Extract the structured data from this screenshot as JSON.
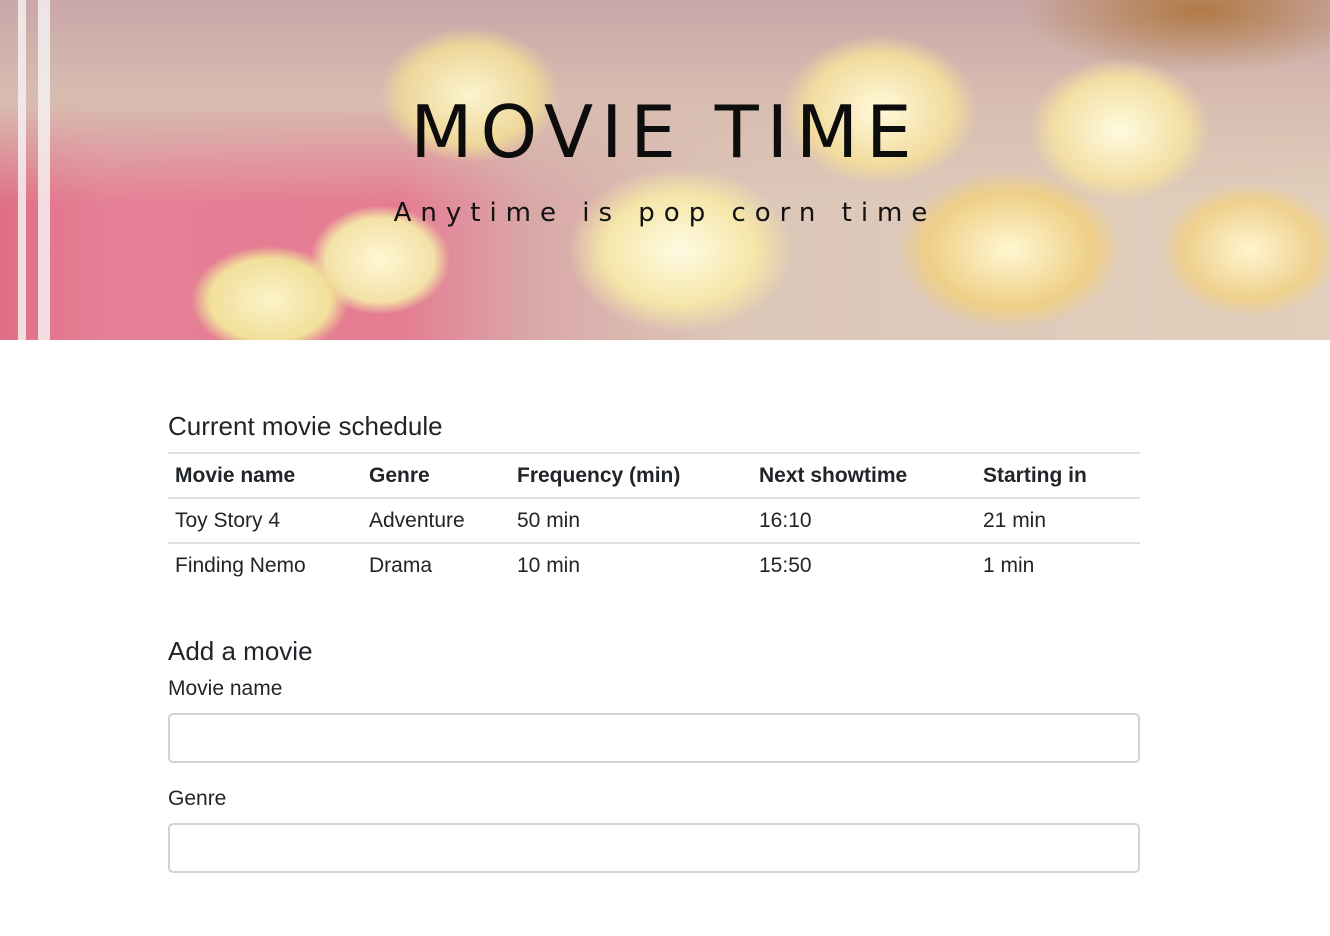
{
  "hero": {
    "title": "MOVIE TIME",
    "subtitle": "Anytime is pop corn time"
  },
  "schedule": {
    "heading": "Current movie schedule",
    "columns": [
      "Movie name",
      "Genre",
      "Frequency (min)",
      "Next showtime",
      "Starting in"
    ],
    "rows": [
      [
        "Toy Story 4",
        "Adventure",
        "50 min",
        "16:10",
        "21 min"
      ],
      [
        "Finding Nemo",
        "Drama",
        "10 min",
        "15:50",
        "1 min"
      ]
    ]
  },
  "add_movie": {
    "heading": "Add a movie",
    "movie_name_label": "Movie name",
    "movie_name_value": "",
    "genre_label": "Genre",
    "genre_value": ""
  }
}
